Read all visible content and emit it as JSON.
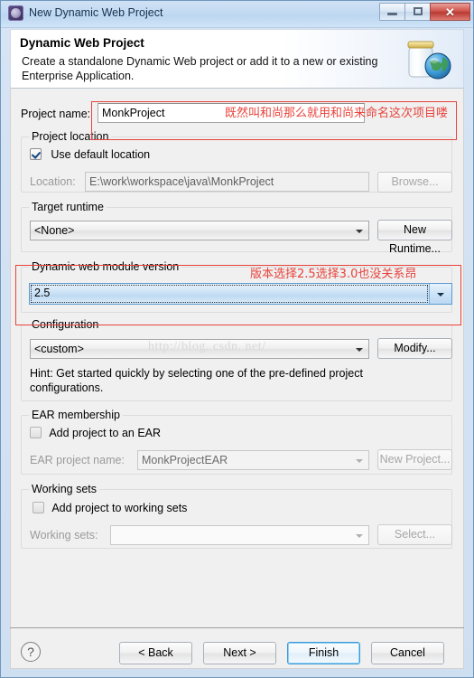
{
  "window": {
    "title": "New Dynamic Web Project",
    "icon": "project-wizard-icon",
    "minimize_label": "–",
    "maximize_label": "❐",
    "close_label": "✕"
  },
  "header": {
    "title": "Dynamic Web Project",
    "description": "Create a standalone Dynamic Web project or add it to a new or existing Enterprise Application.",
    "icon": "jar-globe-icon"
  },
  "form": {
    "project_name_label": "Project name:",
    "project_name_value": "MonkProject",
    "project_location": {
      "group_label": "Project location",
      "use_default_label": "Use default location",
      "use_default_checked": true,
      "location_label": "Location:",
      "location_value": "E:\\work\\workspace\\java\\MonkProject",
      "browse_label": "Browse..."
    },
    "target_runtime": {
      "group_label": "Target runtime",
      "value": "<None>",
      "new_runtime_label": "New Runtime..."
    },
    "module_version": {
      "group_label": "Dynamic web module version",
      "value": "2.5"
    },
    "configuration": {
      "group_label": "Configuration",
      "value": "<custom>",
      "modify_label": "Modify...",
      "hint": "Hint: Get started quickly by selecting one of the pre-defined project configurations."
    },
    "ear_membership": {
      "group_label": "EAR membership",
      "add_label": "Add project to an EAR",
      "add_checked": false,
      "project_name_label": "EAR project name:",
      "project_name_value": "MonkProjectEAR",
      "new_project_label": "New Project..."
    },
    "working_sets": {
      "group_label": "Working sets",
      "add_label": "Add project to working sets",
      "add_checked": false,
      "sets_label": "Working sets:",
      "sets_value": "",
      "select_label": "Select..."
    }
  },
  "annotations": {
    "project_name_note": "既然叫和尚那么就用和尚来命名这次项目喽",
    "module_version_note": "版本选择2.5选择3.0也没关系昂",
    "box_color": "#e8423a"
  },
  "watermark": "http://blog. csdn. net/",
  "footer": {
    "help_label": "?",
    "back_label": "< Back",
    "next_label": "Next >",
    "finish_label": "Finish",
    "cancel_label": "Cancel"
  }
}
